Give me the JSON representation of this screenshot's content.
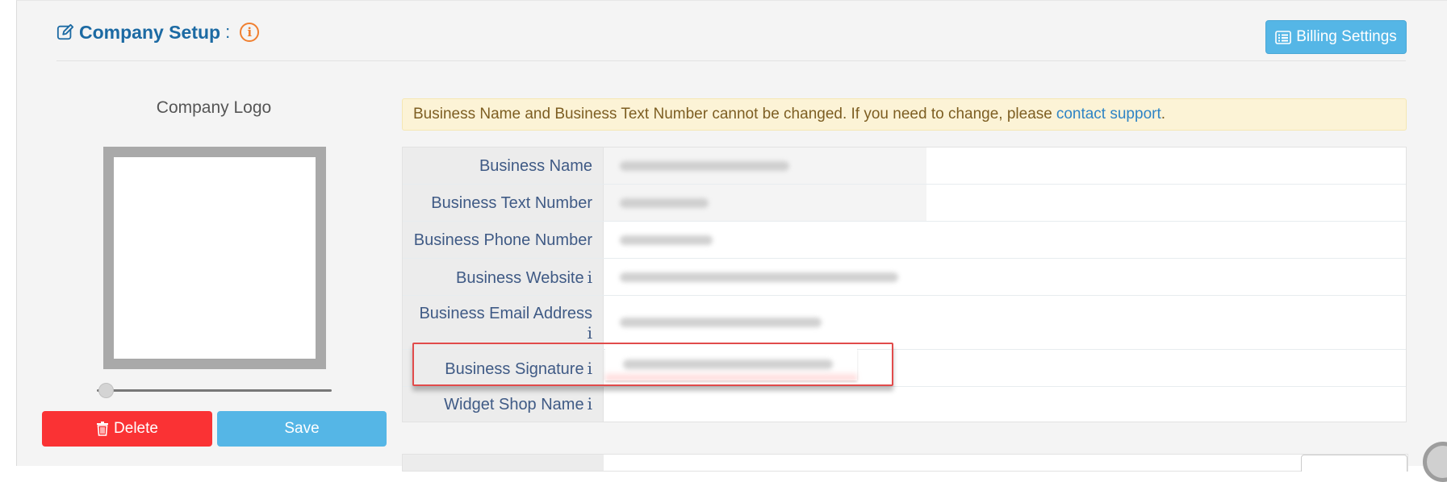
{
  "header": {
    "title": "Company Setup",
    "colon": ":",
    "info_icon": "info-circle-icon",
    "billing_button": "Billing Settings"
  },
  "logo": {
    "label": "Company Logo",
    "zoom_level": 0.0,
    "delete_label": "Delete",
    "save_label": "Save"
  },
  "alert": {
    "text": "Business Name and Business Text Number cannot be changed. If you need to change, please",
    "link": "contact support",
    "tail": "."
  },
  "fields": [
    {
      "label": "Business Name",
      "has_info": false
    },
    {
      "label": "Business Text Number",
      "has_info": false
    },
    {
      "label": "Business Phone Number",
      "has_info": false
    },
    {
      "label": "Business Website",
      "has_info": true
    },
    {
      "label": "Business Email Address",
      "has_info": true
    },
    {
      "label": "Business Signature",
      "has_info": true
    },
    {
      "label": "Widget Shop Name",
      "has_info": true
    }
  ],
  "info_glyph": "i",
  "colors": {
    "primary_blue": "#55b6e6",
    "danger_red": "#fa3234",
    "title_blue": "#1c6aa3",
    "highlight_red": "#e14b4b"
  }
}
